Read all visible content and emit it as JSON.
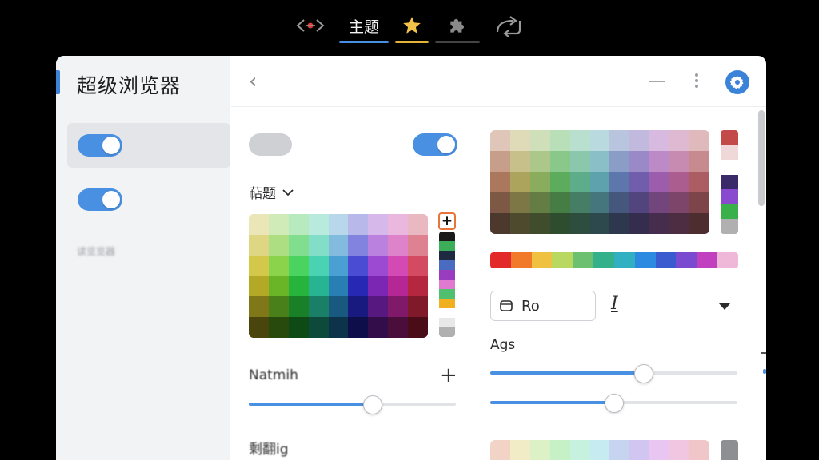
{
  "tabs": [
    {
      "icon": "code-arrows-icon"
    },
    {
      "label": "主题"
    },
    {
      "icon": "star-icon"
    },
    {
      "icon": "puzzle-icon"
    },
    {
      "icon": "share-icon"
    }
  ],
  "sidebar": {
    "title": "超级浏览器",
    "blurred_label": "读览览器"
  },
  "topbar": {
    "back_icon": "‹"
  },
  "left_panel": {
    "theme_dropdown_label": "萜题",
    "slider_label": "Natmih",
    "slider_value": 0.6,
    "bottom_label": "剩翻ig"
  },
  "right_panel": {
    "font_value": "Ro",
    "italic_label": "I",
    "size_label": "Ags",
    "slider1_value": 0.62,
    "slider2_value": 0.5
  },
  "colors": {
    "accent": "#4a90e2",
    "star": "#e2b43a",
    "toggle_on": "#4a90e2"
  }
}
